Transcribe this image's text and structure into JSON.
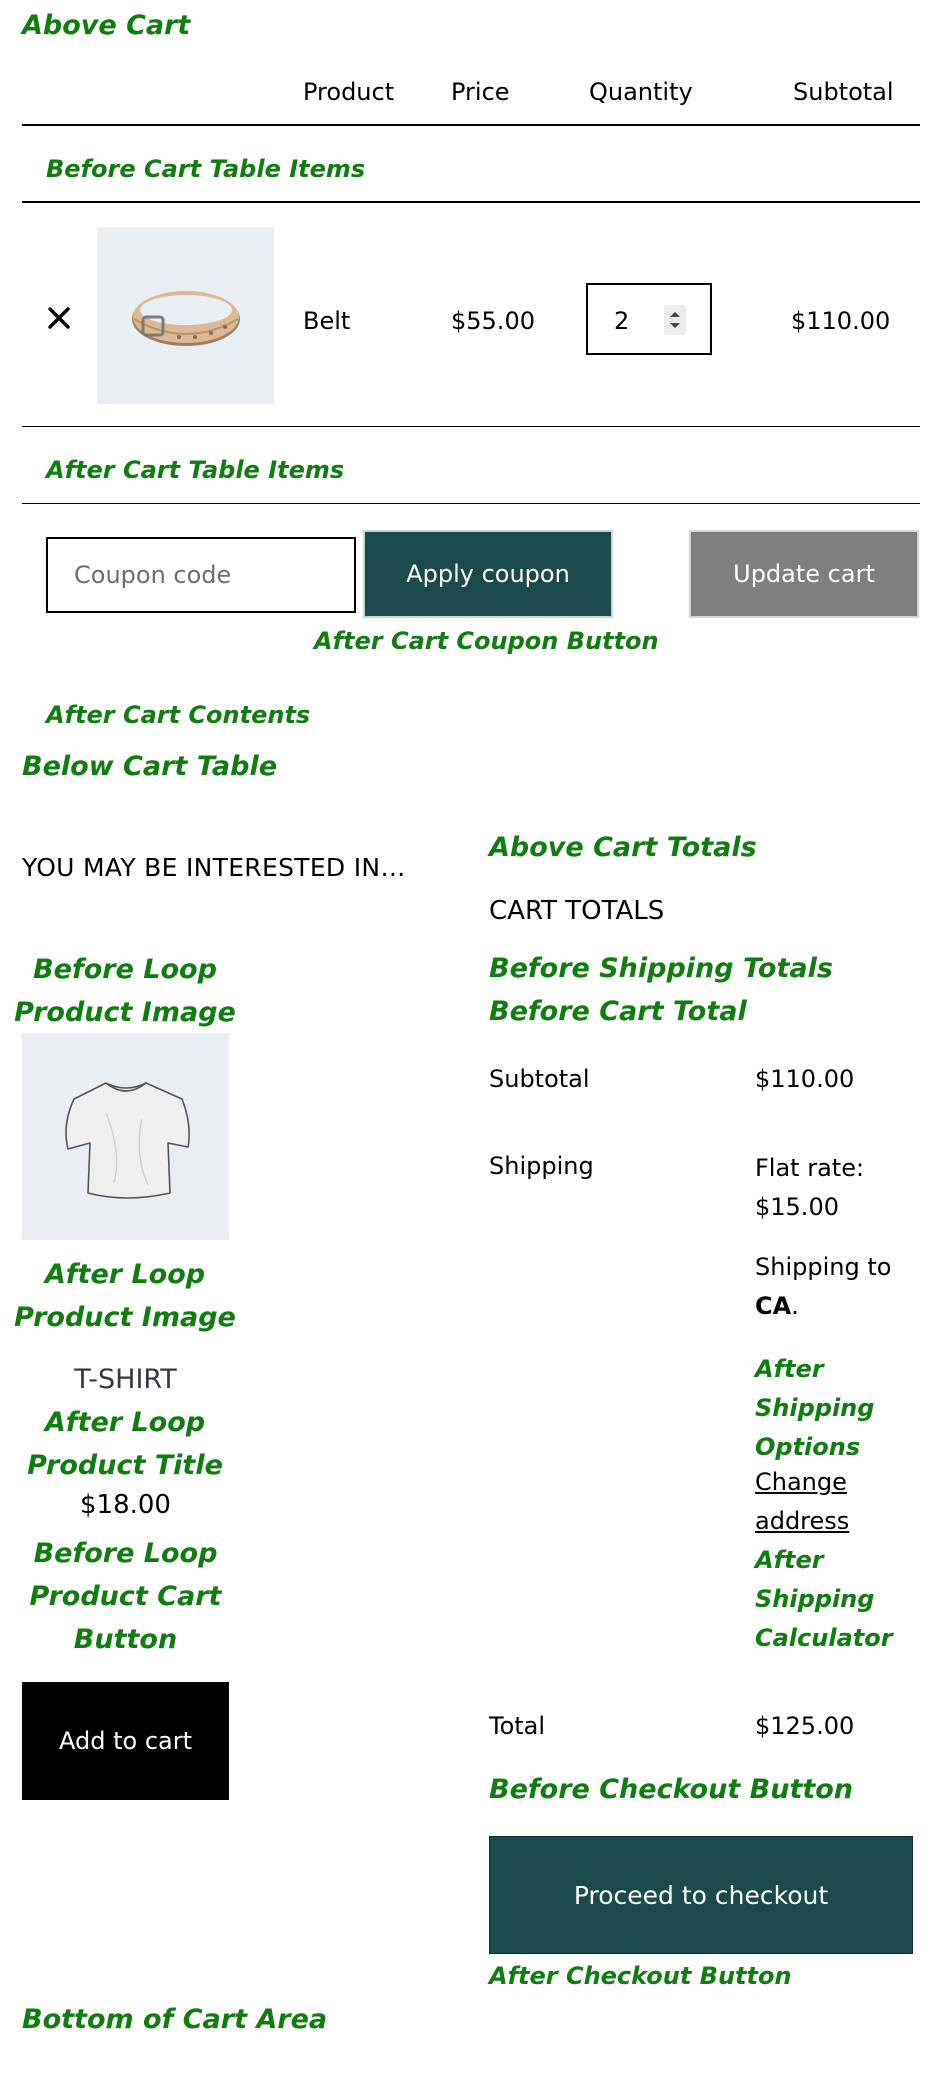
{
  "hooks": {
    "above_cart": "Above Cart",
    "before_cart_table_items": "Before Cart Table Items",
    "after_cart_table_items": "After Cart Table Items",
    "after_cart_coupon_button": "After Cart Coupon Button",
    "after_cart_contents": "After Cart Contents",
    "below_cart_table": "Below Cart Table",
    "above_cart_totals": "Above Cart Totals",
    "before_shipping_totals": "Before Shipping Totals",
    "before_cart_total": "Before Cart Total",
    "before_loop_product_image": "Before Loop Product Image",
    "after_loop_product_image": "After Loop Product Image",
    "after_loop_product_title": "After Loop Product Title",
    "before_loop_product_cart_button": "Before Loop Product Cart Button",
    "after_shipping_options": "After Shipping Options",
    "after_shipping_calculator": "After Shipping Calculator",
    "before_checkout_button": "Before Checkout Button",
    "after_checkout_button": "After Checkout Button",
    "bottom_of_cart_area": "Bottom of Cart Area"
  },
  "cart_table": {
    "headers": {
      "product": "Product",
      "price": "Price",
      "quantity": "Quantity",
      "subtotal": "Subtotal"
    },
    "items": [
      {
        "name": "Belt",
        "price": "$55.00",
        "quantity": "2",
        "subtotal": "$110.00",
        "image_icon": "belt-image"
      }
    ]
  },
  "coupon": {
    "placeholder": "Coupon code",
    "apply_label": "Apply coupon"
  },
  "update_cart_label": "Update cart",
  "cross_sells": {
    "heading": "YOU MAY BE INTERESTED IN…",
    "product": {
      "title": "T-SHIRT",
      "price": "$18.00",
      "add_to_cart_label": "Add to cart",
      "image_icon": "tshirt-image"
    }
  },
  "cart_totals": {
    "heading": "CART TOTALS",
    "subtotal_label": "Subtotal",
    "subtotal_value": "$110.00",
    "shipping_label": "Shipping",
    "shipping_method": "Flat rate: $15.00",
    "shipping_to_prefix": "Shipping to",
    "shipping_to_region": "CA",
    "shipping_to_suffix": ".",
    "change_address_label": "Change address",
    "total_label": "Total",
    "total_value": "$125.00",
    "checkout_label": "Proceed to checkout"
  },
  "colors": {
    "hook_green": "#0f7d0f",
    "brand_teal": "#1b4a4d",
    "update_gray": "#7f7f7f",
    "thumb_bg": "#e9eef3"
  }
}
